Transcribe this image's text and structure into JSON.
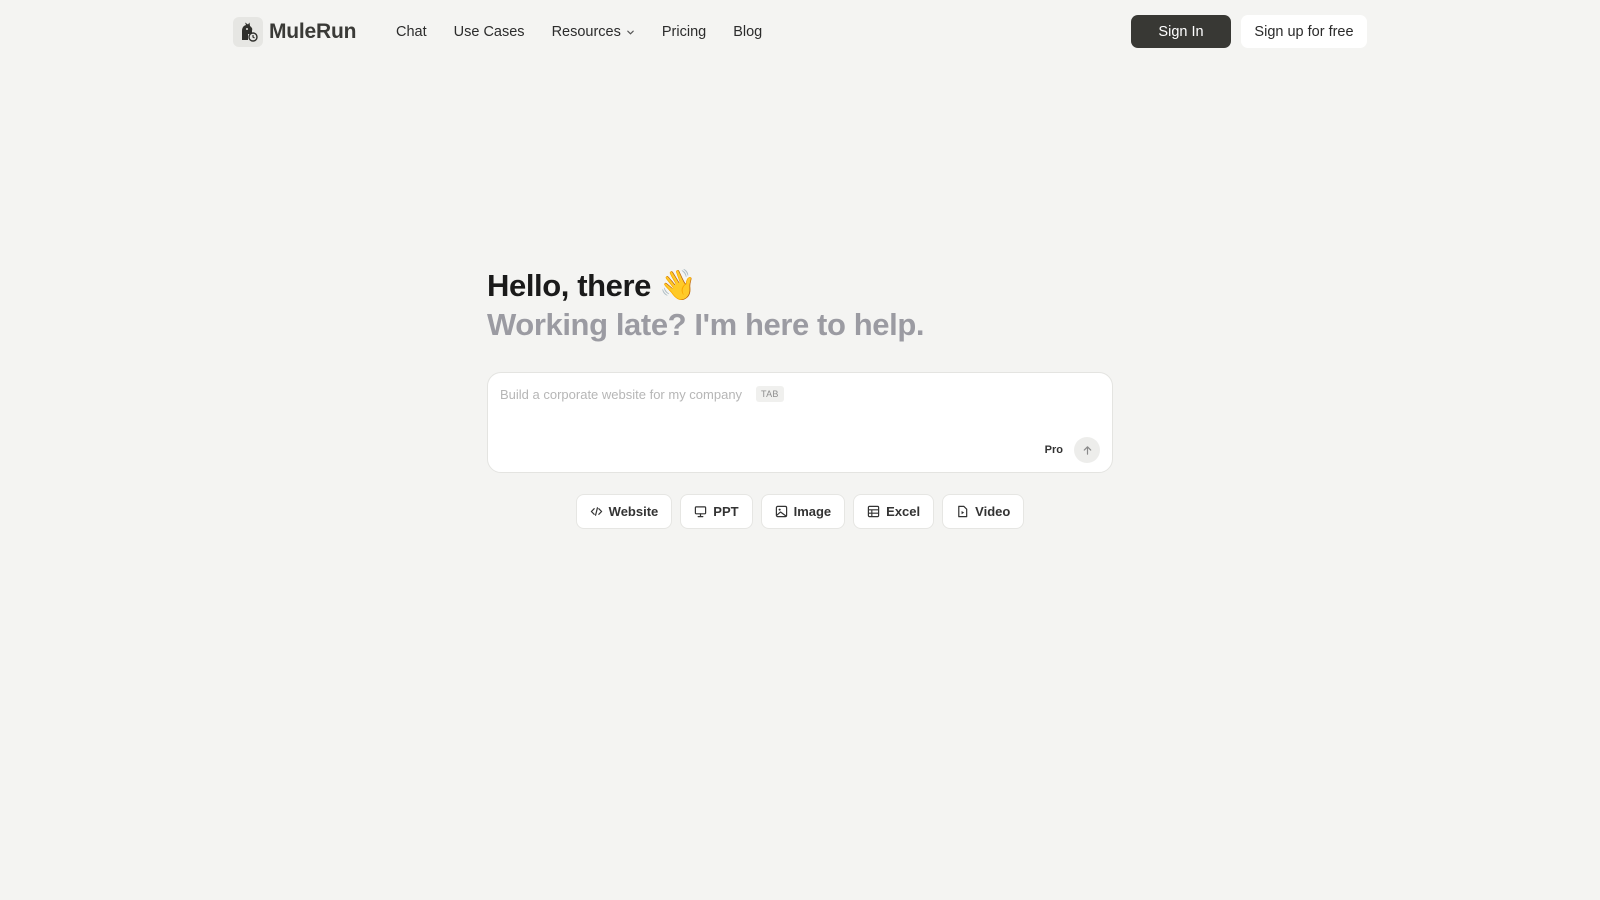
{
  "brand": {
    "name": "MuleRun",
    "logo_icon": "mule-logo-icon"
  },
  "nav": {
    "items": [
      {
        "label": "Chat"
      },
      {
        "label": "Use Cases"
      },
      {
        "label": "Resources",
        "icon": "chevron-down-icon"
      },
      {
        "label": "Pricing"
      },
      {
        "label": "Blog"
      }
    ]
  },
  "auth": {
    "sign_in": "Sign In",
    "sign_up": "Sign up for free"
  },
  "hero": {
    "greeting": "Hello, there",
    "wave": "👋",
    "subtitle": "Working late? I'm here to help."
  },
  "composer": {
    "placeholder": "Build a corporate website for my company",
    "tab_hint": "TAB",
    "mode_label": "Pro",
    "send_icon": "arrow-up-icon"
  },
  "chips": [
    {
      "label": "Website",
      "icon": "code-icon"
    },
    {
      "label": "PPT",
      "icon": "presentation-icon"
    },
    {
      "label": "Image",
      "icon": "image-icon"
    },
    {
      "label": "Excel",
      "icon": "table-icon"
    },
    {
      "label": "Video",
      "icon": "file-video-icon"
    }
  ],
  "colors": {
    "background": "#f4f4f2",
    "primary_button": "#383834",
    "subtitle_gray": "#9b9ba2"
  }
}
